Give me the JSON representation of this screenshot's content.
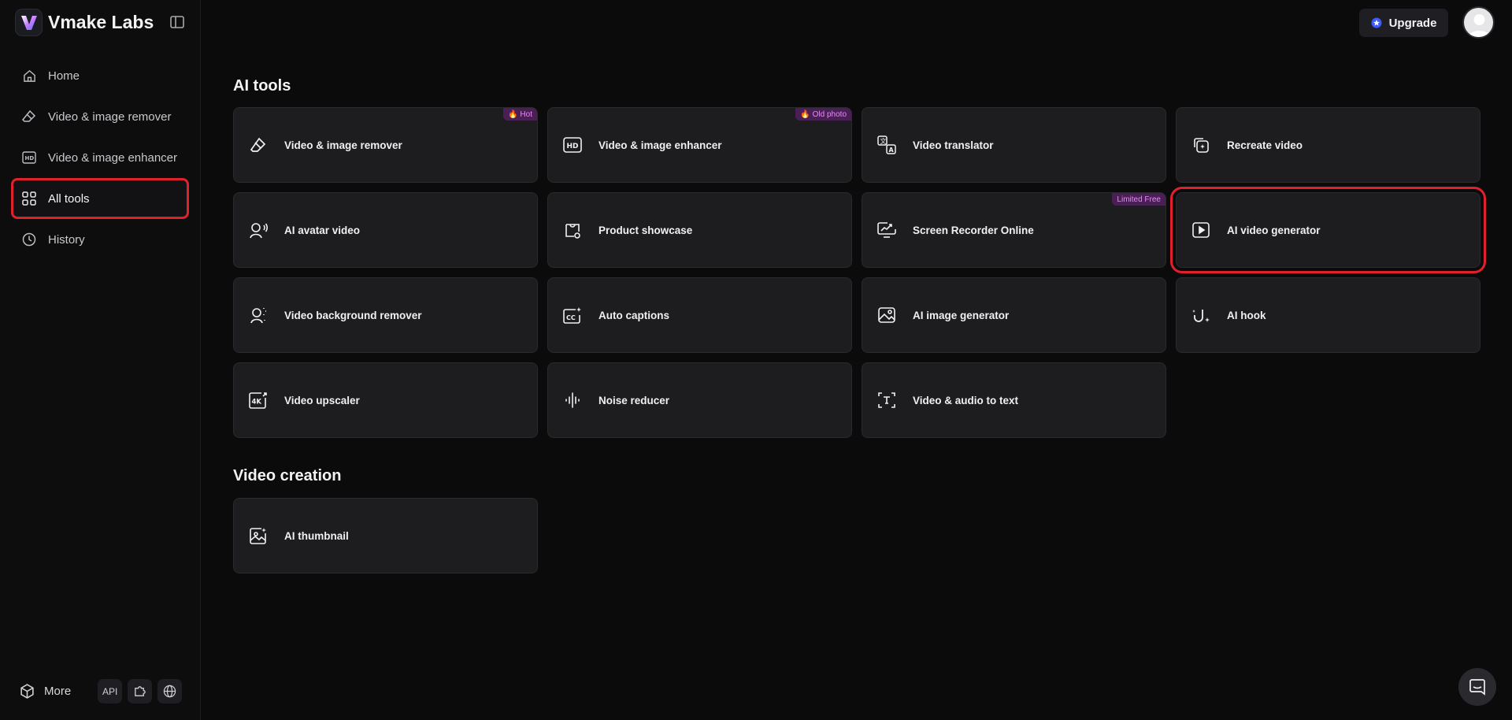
{
  "app": {
    "name": "Vmake Labs"
  },
  "sidebar": {
    "items": [
      {
        "label": "Home",
        "icon": "home-icon"
      },
      {
        "label": "Video & image remover",
        "icon": "eraser-icon"
      },
      {
        "label": "Video & image enhancer",
        "icon": "hd-icon"
      },
      {
        "label": "All tools",
        "icon": "grid-icon",
        "active": true
      },
      {
        "label": "History",
        "icon": "clock-icon"
      }
    ],
    "more_label": "More",
    "api_label": "API"
  },
  "header": {
    "upgrade_label": "Upgrade"
  },
  "sections": {
    "ai_tools": {
      "title": "AI tools",
      "cards": [
        {
          "label": "Video & image remover",
          "badge": "🔥 Hot",
          "icon": "eraser-icon"
        },
        {
          "label": "Video & image enhancer",
          "badge": "🔥 Old photo",
          "icon": "hd-icon"
        },
        {
          "label": "Video translator",
          "icon": "translate-icon"
        },
        {
          "label": "Recreate video",
          "icon": "recreate-icon"
        },
        {
          "label": "AI avatar video",
          "icon": "avatar-voice-icon"
        },
        {
          "label": "Product showcase",
          "icon": "product-icon"
        },
        {
          "label": "Screen Recorder Online",
          "badge": "Limited Free",
          "icon": "screen-recorder-icon"
        },
        {
          "label": "AI video generator",
          "icon": "play-icon",
          "highlighted": true
        },
        {
          "label": "Video background remover",
          "icon": "person-bg-icon"
        },
        {
          "label": "Auto captions",
          "icon": "cc-icon"
        },
        {
          "label": "AI image generator",
          "icon": "image-icon"
        },
        {
          "label": "AI hook",
          "icon": "hook-icon"
        },
        {
          "label": "Video upscaler",
          "icon": "4k-icon"
        },
        {
          "label": "Noise reducer",
          "icon": "waveform-icon"
        },
        {
          "label": "Video & audio to text",
          "icon": "text-icon"
        }
      ]
    },
    "video_creation": {
      "title": "Video creation",
      "cards": [
        {
          "label": "AI thumbnail",
          "icon": "thumbnail-icon"
        }
      ]
    }
  },
  "colors": {
    "highlight": "#e0202b",
    "badge_bg": "#4a1f55",
    "badge_text": "#e58cf5",
    "card_bg": "#1d1d20"
  }
}
